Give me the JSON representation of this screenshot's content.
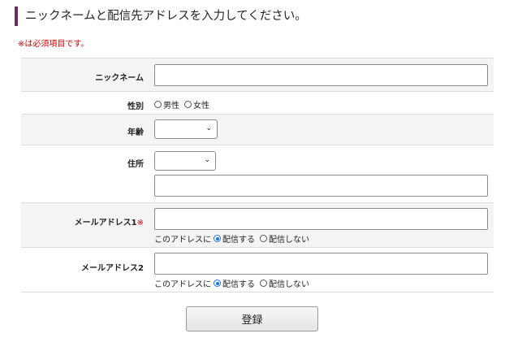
{
  "page": {
    "heading": "ニックネームと配信先アドレスを入力してください。",
    "required_note": "※は必須項目です。"
  },
  "form": {
    "nickname": {
      "label": "ニックネーム",
      "value": ""
    },
    "gender": {
      "label": "性別",
      "options": [
        "男性",
        "女性"
      ]
    },
    "age": {
      "label": "年齢",
      "selected": ""
    },
    "address": {
      "label": "住所",
      "selected": "",
      "value": ""
    },
    "email1": {
      "label": "メールアドレス1",
      "required_mark": "※",
      "value": "",
      "delivery_prefix": "このアドレスに",
      "options": [
        "配信する",
        "配信しない"
      ],
      "selected": "配信する"
    },
    "email2": {
      "label": "メールアドレス2",
      "value": "",
      "delivery_prefix": "このアドレスに",
      "options": [
        "配信する",
        "配信しない"
      ],
      "selected": "配信する"
    }
  },
  "submit_label": "登録",
  "colors": {
    "accent_bar": "#6b2d5c",
    "required": "#d40000",
    "radio_checked": "#1a73e8"
  },
  "icons": {
    "select_arrow": "chevron-down-icon"
  }
}
